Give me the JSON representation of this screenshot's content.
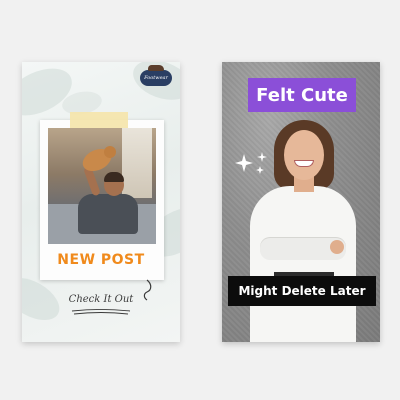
{
  "left_story": {
    "brand_badge": "Footwear",
    "headline": "NEW POST",
    "cta": "Check It Out",
    "colors": {
      "headline": "#f08a1c",
      "badge": "#2a3e63",
      "tape": "#f5e4aa"
    },
    "photo_icon": "man-with-cat-photo"
  },
  "right_story": {
    "top_label": "Felt Cute",
    "bottom_label": "Might Delete Later",
    "colors": {
      "top_label_bg": "#8b4fd8",
      "bottom_label_bg": "#0c0c0c",
      "background": "#8e8e8e"
    },
    "photo_icon": "smiling-woman-photo",
    "decoration_icon": "sparkle-icon"
  }
}
